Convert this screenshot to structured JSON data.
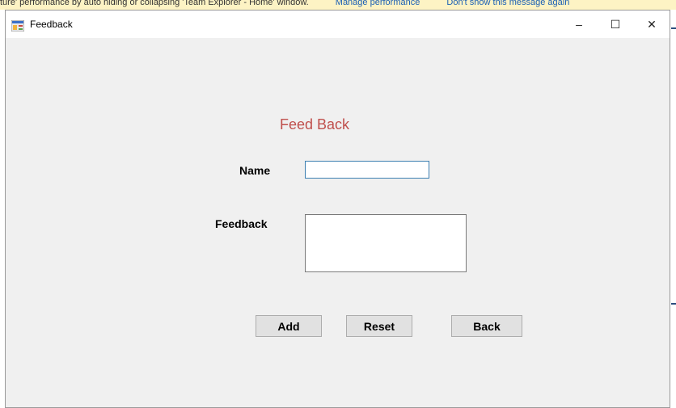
{
  "window": {
    "title": "Feedback",
    "controls": {
      "minimize": "–",
      "maximize": "☐",
      "close": "✕"
    }
  },
  "background_app": {
    "notice_text": "ture' performance by auto hiding or collapsing 'Team Explorer - Home' window.",
    "link_manage": "Manage performance",
    "link_dont_show": "Don't show this message again"
  },
  "form": {
    "heading": "Feed Back",
    "name_label": "Name",
    "name_value": "",
    "feedback_label": "Feedback",
    "feedback_value": ""
  },
  "buttons": {
    "add": "Add",
    "reset": "Reset",
    "back": "Back"
  },
  "colors": {
    "heading": "#c0504d",
    "input_focus_border": "#3c7fb1",
    "window_bg": "#f0f0f0"
  },
  "icons": {
    "app": "winforms-app-icon"
  }
}
